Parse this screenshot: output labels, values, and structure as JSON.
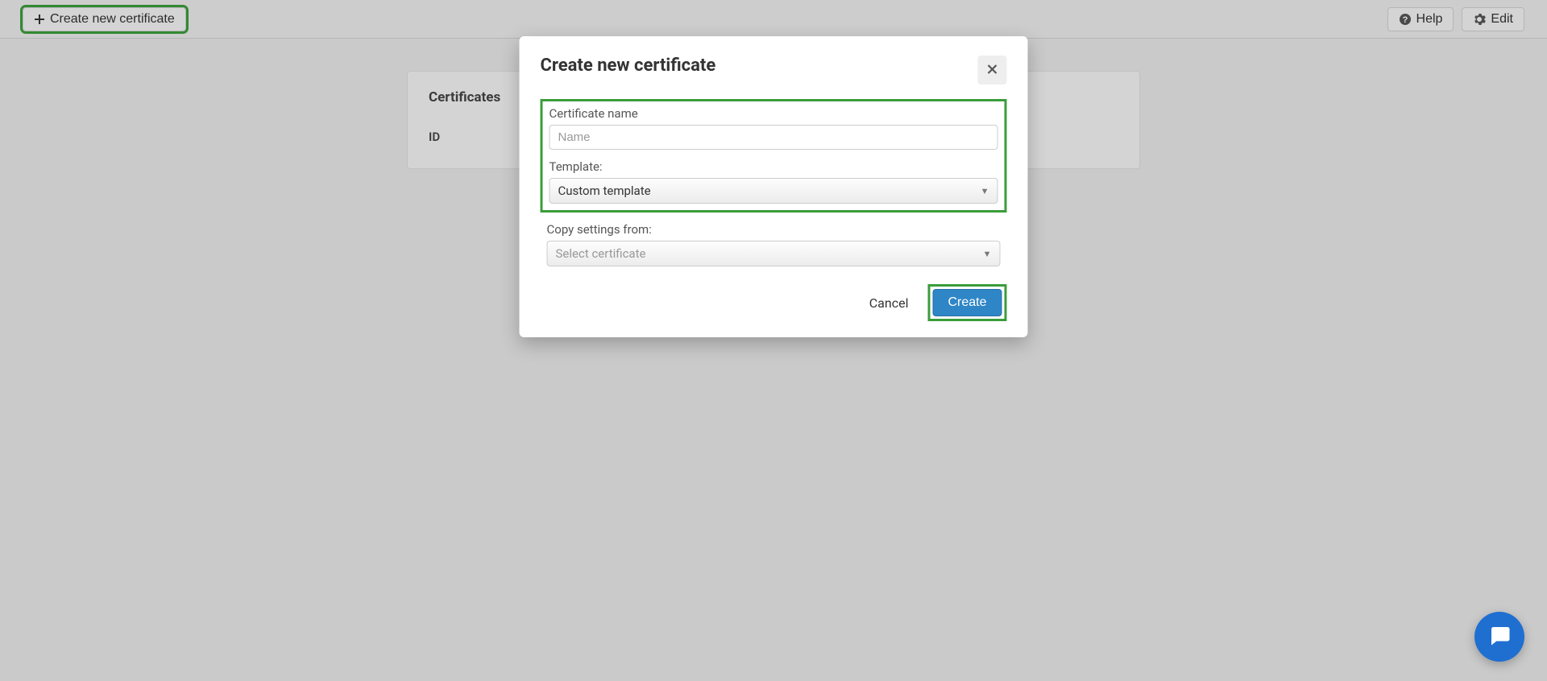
{
  "toolbar": {
    "create_label": "Create new certificate",
    "help_label": "Help",
    "edit_label": "Edit"
  },
  "panel": {
    "title": "Certificates",
    "col_id": "ID"
  },
  "modal": {
    "title": "Create new certificate",
    "name_label": "Certificate name",
    "name_placeholder": "Name",
    "name_value": "",
    "template_label": "Template:",
    "template_value": "Custom template",
    "copy_label": "Copy settings from:",
    "copy_placeholder": "Select certificate",
    "cancel_label": "Cancel",
    "create_label": "Create"
  }
}
